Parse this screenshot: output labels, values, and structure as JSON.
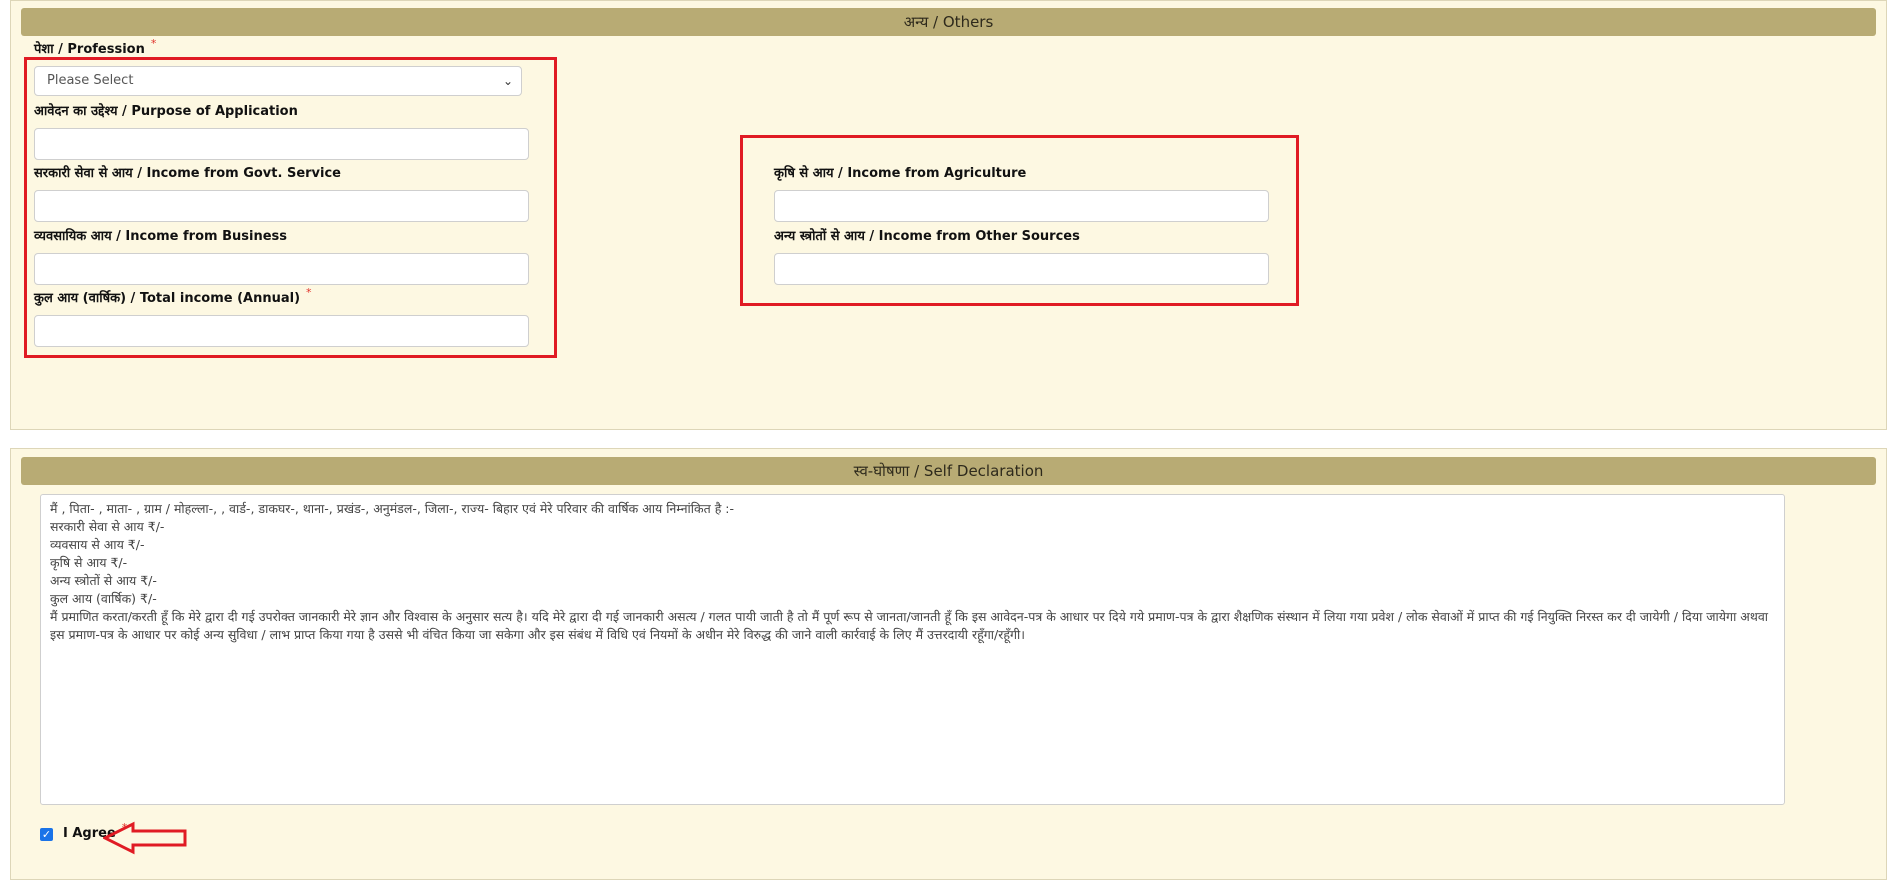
{
  "others": {
    "header": "अन्य / Others",
    "profession": {
      "label": "पेशा / Profession",
      "required": "*",
      "placeholder": "Please Select",
      "chevron_icon": "chevron-down-icon"
    },
    "purpose": {
      "label": "आवेदन का उद्देश्य / Purpose of Application",
      "value": ""
    },
    "govt_income": {
      "label": "सरकारी सेवा से आय / Income from Govt. Service",
      "value": ""
    },
    "business_income": {
      "label": "व्यवसायिक आय / Income from Business",
      "value": ""
    },
    "total_income": {
      "label": "कुल आय (वार्षिक) / Total income (Annual)",
      "required": "*",
      "value": ""
    },
    "agri_income": {
      "label": "कृषि से आय / Income from Agriculture",
      "value": ""
    },
    "other_income": {
      "label": "अन्य स्त्रोतों से आय / Income from Other Sources",
      "value": ""
    }
  },
  "declaration": {
    "header": "स्व-घोषणा / Self Declaration",
    "lines": [
      "मैं ,  पिता- , माता- ,  ग्राम / मोहल्ला-, , वार्ड-, डाकघर-, थाना-, प्रखंड-, अनुमंडल-, जिला-, राज्य- बिहार एवं मेरे परिवार की वार्षिक आय निम्नांकित है :-",
      "सरकारी सेवा से आय ₹/-",
      "व्यवसाय से आय ₹/-",
      "कृषि से आय ₹/-",
      "अन्य स्त्रोतों से आय ₹/-",
      "कुल आय (वार्षिक) ₹/-",
      "मैं  प्रमाणित करता/करती हूँ कि मेरे द्वारा दी गई उपरोक्त जानकारी मेरे ज्ञान और विश्वास के अनुसार सत्य है। यदि मेरे द्वारा दी गई जानकारी असत्य / गलत पायी जाती है तो मैं पूर्ण रूप से जानता/जानती हूँ कि इस आवेदन-पत्र के आधार पर दिये गये प्रमाण-पत्र के द्वारा शैक्षणिक संस्थान में लिया गया प्रवेश / लोक सेवाओं में प्राप्त की गई नियुक्ति निरस्त कर दी जायेगी / दिया जायेगा अथवा इस प्रमाण-पत्र के आधार पर कोई अन्य सुविधा / लाभ प्राप्त किया गया है उससे भी वंचित किया जा सकेगा और इस संबंध में विधि एवं नियमों के अधीन मेरे विरुद्ध की जाने वाली कार्रवाई के लिए मैं उत्तरदायी रहूँगा/रहूँगी।"
    ],
    "agree": {
      "label": "I Agree",
      "required": "*",
      "checked": true
    },
    "checkmark_icon": "checkmark-icon",
    "arrow_icon": "arrow-left-icon"
  },
  "colors": {
    "panel_bg": "#fdf8e2",
    "header_bg": "#b8ab74",
    "highlight": "#e01b24",
    "required": "#e0322a",
    "checkbox": "#1a73e8"
  }
}
